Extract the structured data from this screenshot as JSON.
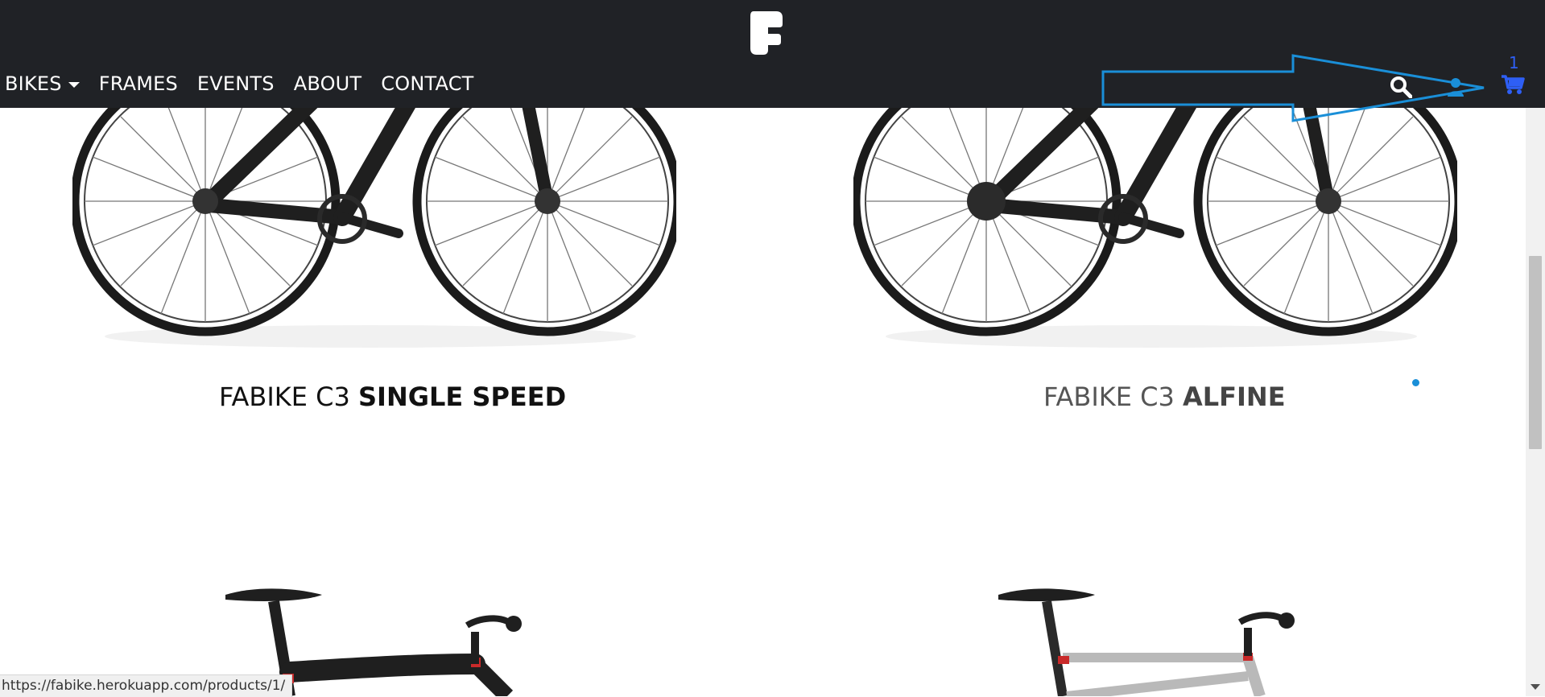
{
  "nav": {
    "items": [
      {
        "label": "BIKES",
        "has_dropdown": true
      },
      {
        "label": "FRAMES"
      },
      {
        "label": "EVENTS"
      },
      {
        "label": "ABOUT"
      },
      {
        "label": "CONTACT"
      }
    ],
    "logo_icon": "fabike-logo-icon",
    "search_icon": "search-icon",
    "user_icon": "user-icon",
    "cart": {
      "count": "1",
      "icon": "cart-icon",
      "color": "#2e5ff5"
    },
    "background": "#202226"
  },
  "products": [
    {
      "brand": "FABIKE C3 ",
      "model": "SINGLE SPEED"
    },
    {
      "brand": "FABIKE C3 ",
      "model": "ALFINE"
    }
  ],
  "status_url": "https://fabike.herokuapp.com/products/1/",
  "annotation": {
    "type": "arrow",
    "color": "#1a8fd8",
    "points_to": "cart"
  }
}
